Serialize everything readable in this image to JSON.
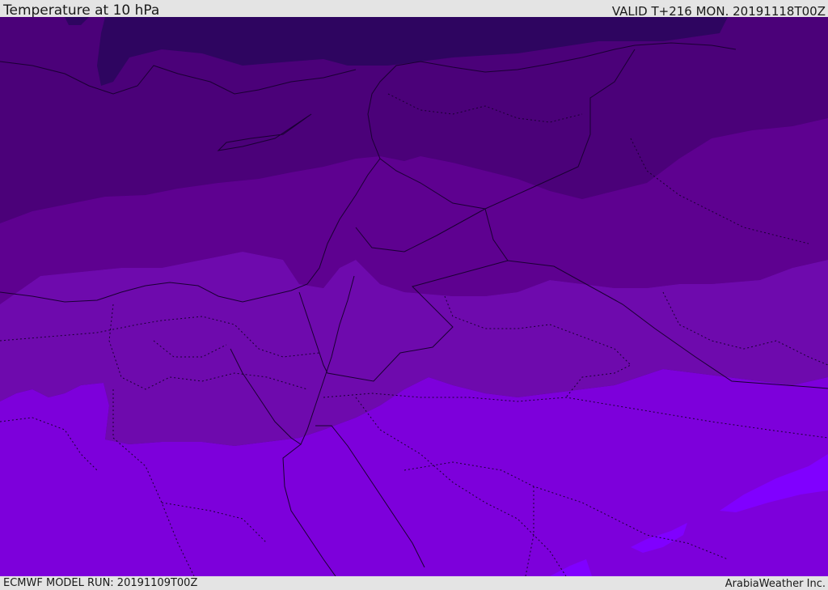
{
  "header": {
    "title": "Temperature at 10 hPa",
    "valid": "VALID T+216 MON. 20191118T00Z"
  },
  "footer": {
    "model_run": "ECMWF MODEL RUN: 20191109T00Z",
    "credit": "ArabiaWeather Inc."
  },
  "colors": {
    "band_darkest": "#2e0560",
    "band_dark": "#4b0179",
    "band_mid": "#5e0190",
    "band_light": "#6e0aad",
    "band_bright": "#7d00db",
    "band_brightest": "#8000ff",
    "boundary_line": "#1a0033"
  }
}
